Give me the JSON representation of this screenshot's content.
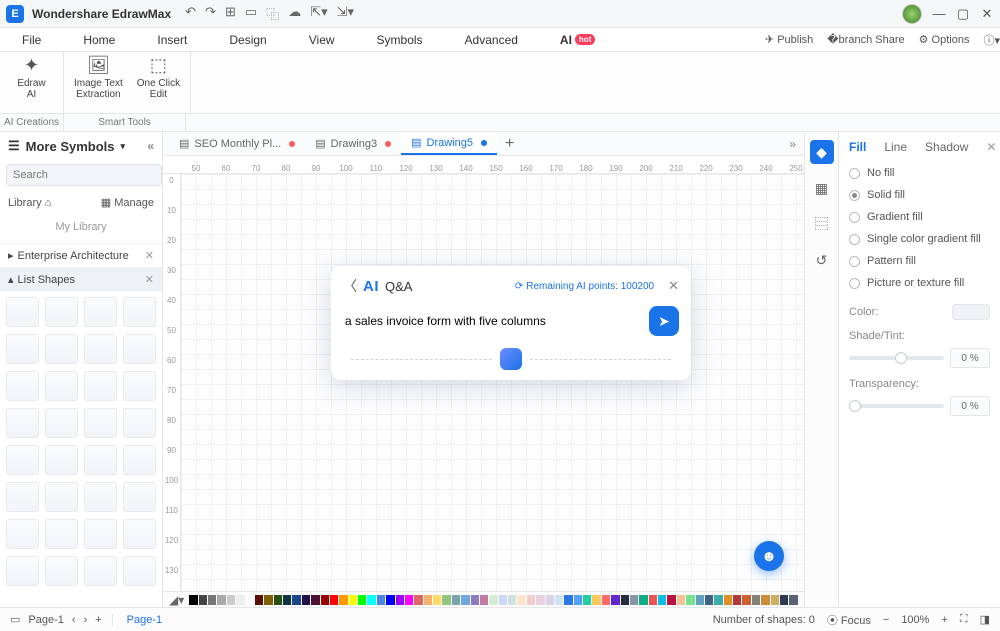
{
  "app": {
    "title": "Wondershare EdrawMax"
  },
  "menubar": {
    "items": [
      "File",
      "Home",
      "Insert",
      "Design",
      "View",
      "Symbols",
      "Advanced"
    ],
    "ai": "AI",
    "hot": "hot",
    "publish": "Publish",
    "share": "Share",
    "options": "Options"
  },
  "ribbon": {
    "edrawAi": "Edraw\nAI",
    "imgText": "Image Text\nExtraction",
    "oneClick": "One Click\nEdit",
    "group1": "AI Creations",
    "group2": "Smart Tools"
  },
  "left": {
    "title": "More Symbols",
    "search_placeholder": "Search",
    "search_btn": "Search",
    "library": "Library",
    "manage": "Manage",
    "mylib": "My Library",
    "sec1": "Enterprise Architecture",
    "sec2": "List Shapes"
  },
  "docTabs": {
    "t1": "SEO Monthly Pl...",
    "t2": "Drawing3",
    "t3": "Drawing5"
  },
  "rulerH": [
    "50",
    "60",
    "70",
    "80",
    "90",
    "100",
    "110",
    "120",
    "130",
    "140",
    "150",
    "160",
    "170",
    "180",
    "190",
    "200",
    "210",
    "220",
    "230",
    "240",
    "250"
  ],
  "rulerV": [
    "0",
    "10",
    "20",
    "30",
    "40",
    "50",
    "60",
    "70",
    "80",
    "90",
    "100",
    "110",
    "120",
    "130"
  ],
  "aiqa": {
    "title": "Q&A",
    "ai": "AI",
    "points": "Remaining AI points: 100200",
    "prompt": "a sales invoice form with five columns"
  },
  "rpanel": {
    "tabs": {
      "fill": "Fill",
      "line": "Line",
      "shadow": "Shadow"
    },
    "fills": [
      "No fill",
      "Solid fill",
      "Gradient fill",
      "Single color gradient fill",
      "Pattern fill",
      "Picture or texture fill"
    ],
    "color": "Color:",
    "shade": "Shade/Tint:",
    "shade_val": "0 %",
    "transp": "Transparency:",
    "transp_val": "0 %"
  },
  "status": {
    "page": "Page-1",
    "activePage": "Page-1",
    "shapes": "Number of shapes: 0",
    "focus": "Focus",
    "zoom": "100%"
  },
  "palette": [
    "#000",
    "#444",
    "#777",
    "#aaa",
    "#ccc",
    "#eee",
    "#fff",
    "#5b0f00",
    "#7f6000",
    "#274e13",
    "#0c343d",
    "#1c4587",
    "#20124d",
    "#4c1130",
    "#980000",
    "#f00",
    "#f90",
    "#ff0",
    "#0f0",
    "#0ff",
    "#4a86e8",
    "#00f",
    "#90f",
    "#f0f",
    "#e06666",
    "#f6b26b",
    "#ffd966",
    "#93c47d",
    "#76a5af",
    "#6fa8dc",
    "#8e7cc3",
    "#c27ba0",
    "#d9ead3",
    "#c9daf8",
    "#d0e0e3",
    "#fce5cd",
    "#f4cccc",
    "#ead1dc",
    "#d9d2e9",
    "#cfe2f3",
    "#2b78e4",
    "#54a0ff",
    "#1dd1a1",
    "#feca57",
    "#ff6b6b",
    "#5f27cd",
    "#222f3e",
    "#8395a7",
    "#10ac84",
    "#ee5253",
    "#0abde3",
    "#b71540",
    "#f8c291",
    "#78e08f",
    "#60a3bc",
    "#3c6382",
    "#38ada9",
    "#e58e26",
    "#b33939",
    "#cd6133",
    "#84817a",
    "#cc8e35",
    "#ccae62",
    "#303952",
    "#596275"
  ]
}
